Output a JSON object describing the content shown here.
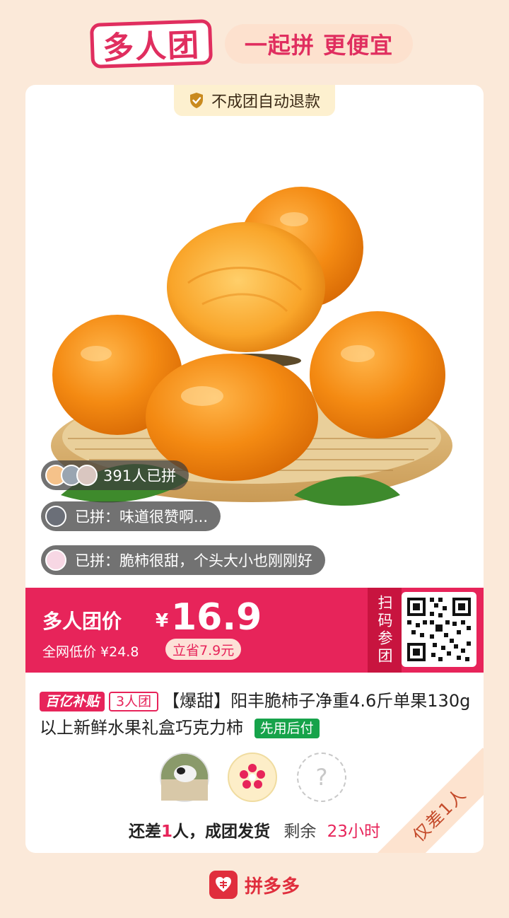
{
  "header": {
    "logo_text": "多人团",
    "slogan": "一起拼 更便宜"
  },
  "card": {
    "refund_badge": "不成团自动退款",
    "bubbles": [
      {
        "text": "391人已拼"
      },
      {
        "text": "已拼：味道很赞啊..."
      },
      {
        "text": "已拼：脆柿很甜，个头大小也刚刚好"
      }
    ],
    "price": {
      "label": "多人团价",
      "currency": "¥",
      "value": "16.9",
      "low_price_text": "全网低价 ¥24.8",
      "save_text": "立省7.9元",
      "scan_label": "扫码参团"
    },
    "title": {
      "tag_subsidy": "百亿补贴",
      "tag_group": "3人团",
      "text": "【爆甜】阳丰脆柿子净重4.6斤单果130g以上新鲜水果礼盒巧克力柿",
      "tag_pay": "先用后付"
    },
    "members": {
      "placeholder": "?"
    },
    "status": {
      "need_prefix": "还差",
      "need_count": "1",
      "need_suffix": "人，成团发货",
      "remain_label": "剩余",
      "remain_time": "23小时"
    },
    "corner_ribbon": "仅差1人"
  },
  "footer": {
    "brand": "拼多多"
  },
  "colors": {
    "brand_red": "#e7245a",
    "background": "#fbe9d9",
    "gold_badge": "#fdf0cf",
    "green_tag": "#16a34a"
  }
}
